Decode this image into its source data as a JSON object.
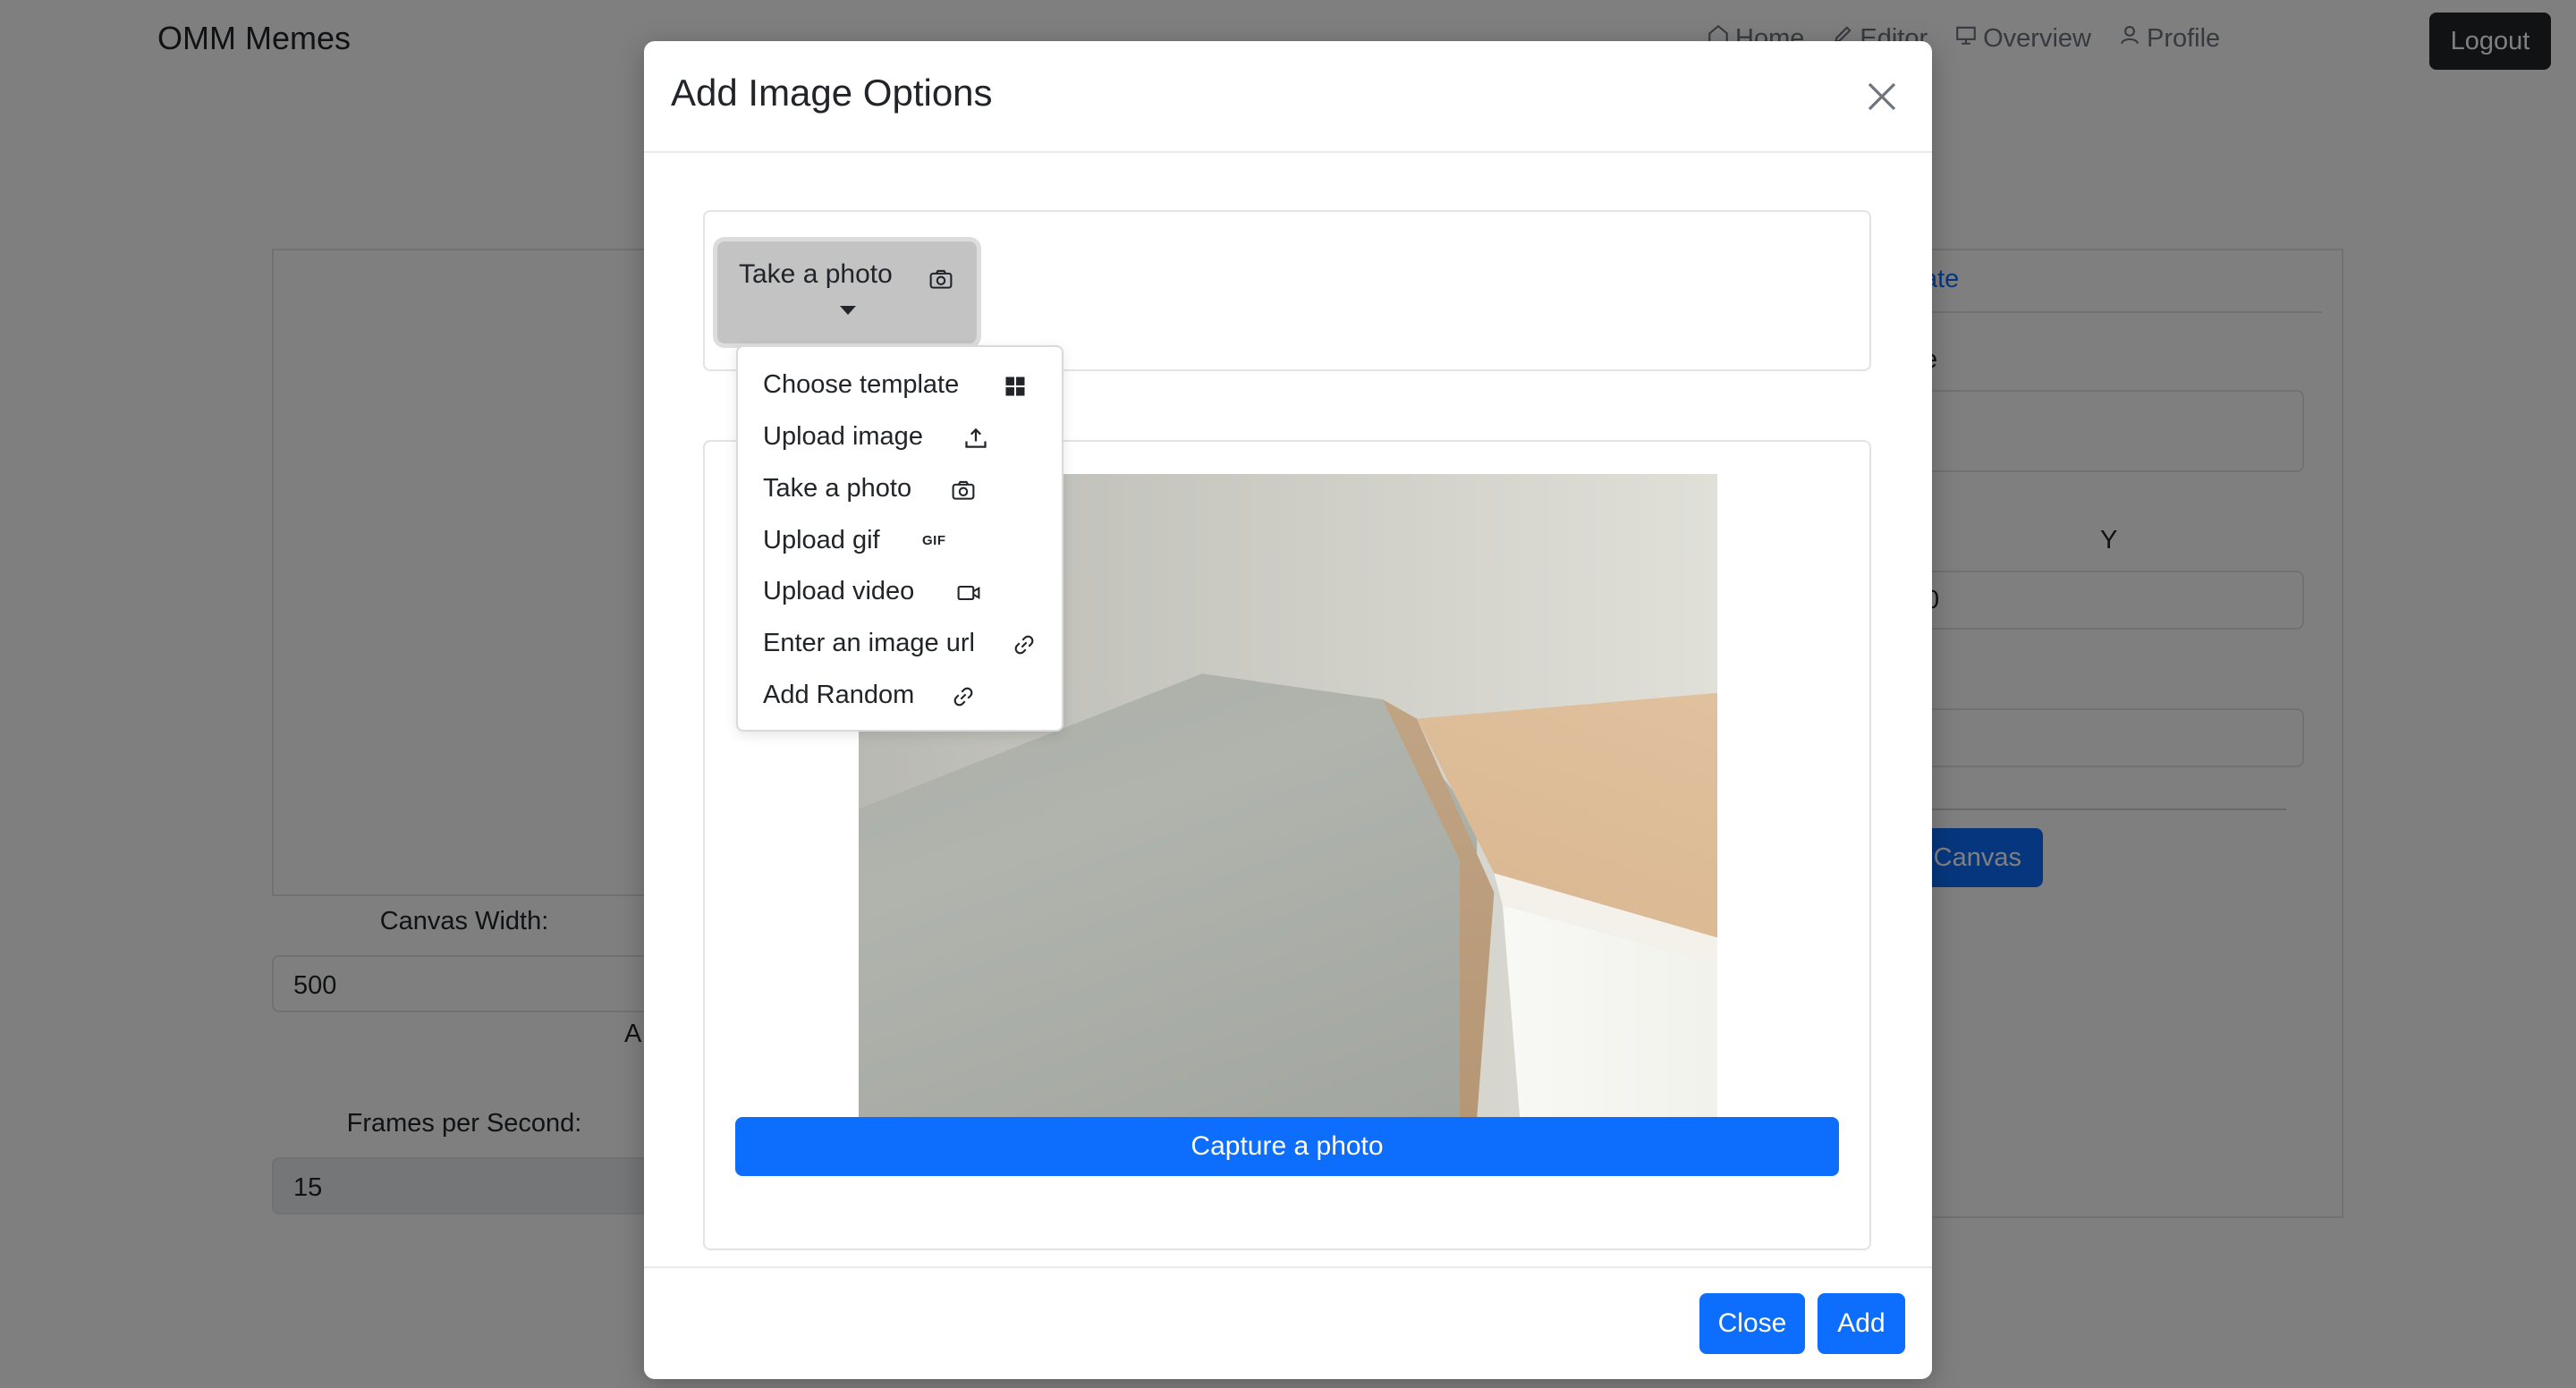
{
  "navbar": {
    "brand": "OMM Memes",
    "links": [
      {
        "label": "Home",
        "icon": "home-icon"
      },
      {
        "label": "Editor",
        "icon": "pencil-icon"
      },
      {
        "label": "Overview",
        "icon": "presentation-icon"
      },
      {
        "label": "Profile",
        "icon": "person-icon"
      }
    ],
    "logout_label": "Logout"
  },
  "editor": {
    "canvas_width_label": "Canvas Width:",
    "canvas_width_value": "500",
    "partial_label": "A",
    "fps_label": "Frames per Second:",
    "fps_value": "15"
  },
  "right_panel": {
    "tab_link_partial": "ate",
    "field_label_partial": "e",
    "y_label": "Y",
    "y_value": "0",
    "small_label_partial": ")",
    "canvas_button_partial": "Canvas"
  },
  "modal": {
    "title": "Add Image Options",
    "source_toggle": {
      "label": "Take a photo",
      "icon": "camera-icon"
    },
    "menu_items": [
      {
        "label": "Choose template",
        "icon": "grid-icon"
      },
      {
        "label": "Upload image",
        "icon": "upload-icon"
      },
      {
        "label": "Take a photo",
        "icon": "camera-icon"
      },
      {
        "label": "Upload gif",
        "icon": "gif-icon",
        "icon_text": "GIF"
      },
      {
        "label": "Upload video",
        "icon": "video-icon"
      },
      {
        "label": "Enter an image url",
        "icon": "link-icon"
      },
      {
        "label": "Add Random",
        "icon": "link-icon"
      }
    ],
    "capture_label": "Capture a photo",
    "close_label": "Close",
    "add_label": "Add"
  },
  "colors": {
    "primary": "#0d6efd",
    "dark": "#212529",
    "backdrop": "rgba(0,0,0,0.5)"
  }
}
